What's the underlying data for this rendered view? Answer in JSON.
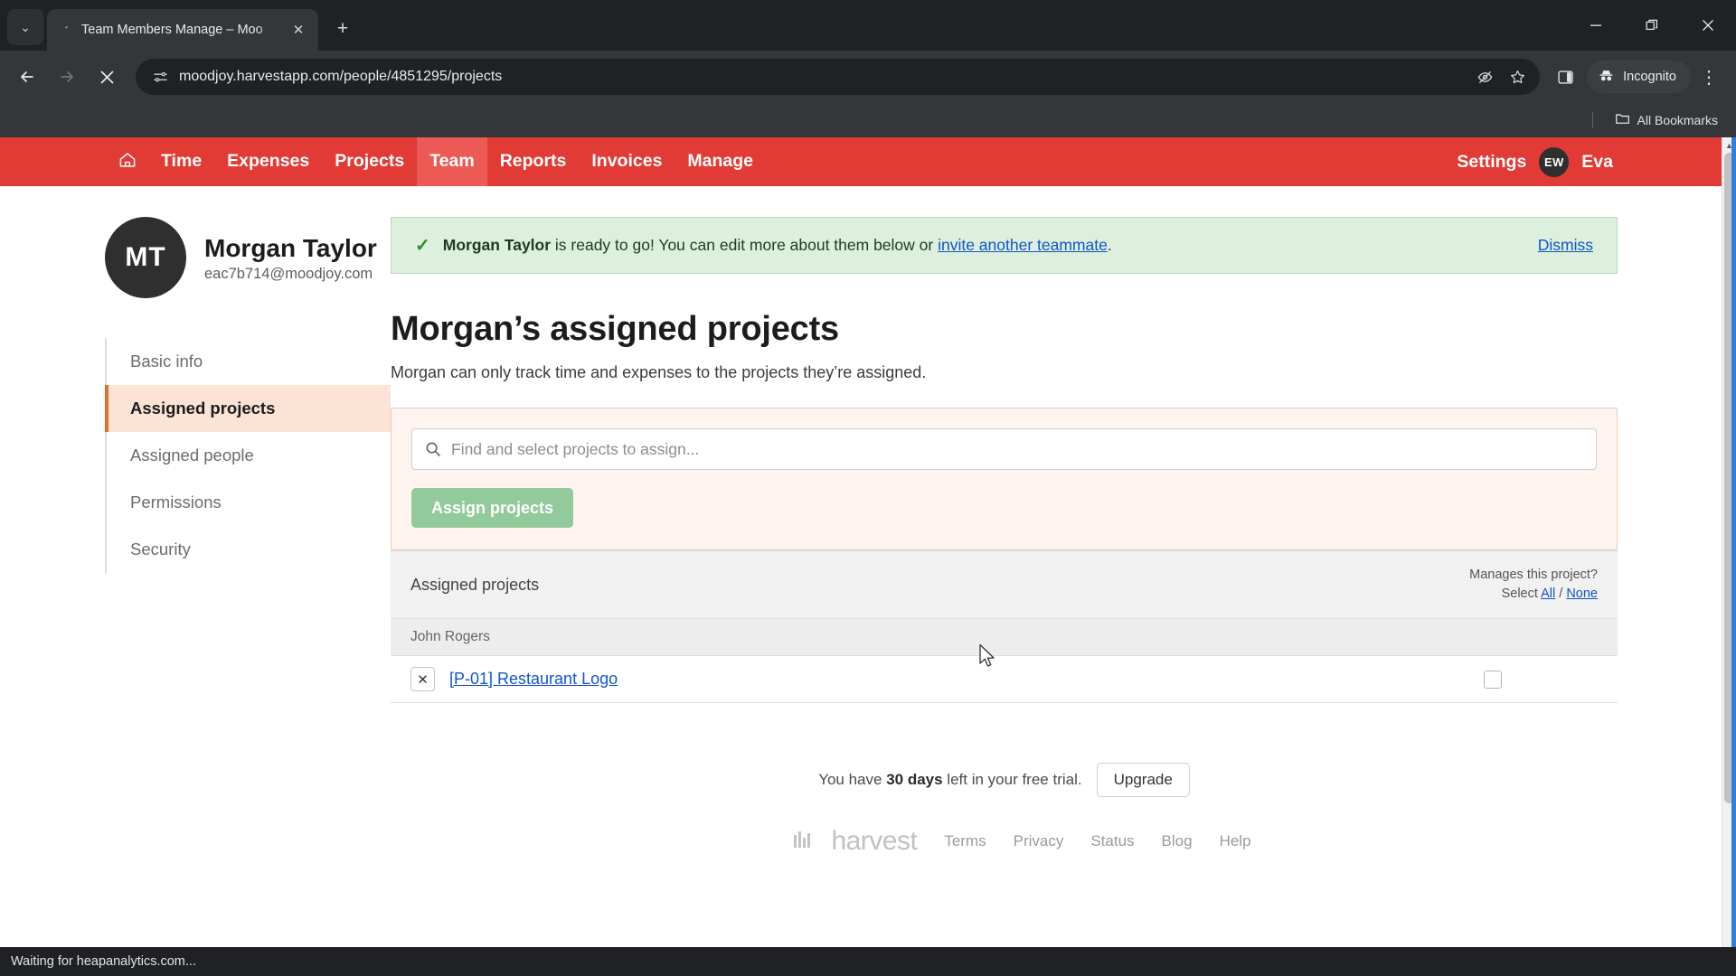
{
  "browser": {
    "tab": {
      "title": "Team Members Manage – Moo",
      "favicon_name": "harvest-favicon",
      "close_label": "✕",
      "new_tab_label": "+"
    },
    "tab_search_label": "⌄",
    "window_controls": {
      "minimize": "—",
      "maximize": "❐",
      "close": "✕"
    },
    "toolbar": {
      "back": "←",
      "forward": "→",
      "stop": "✕",
      "url": "moodjoy.harvestapp.com/people/4851295/projects",
      "site_info_name": "site-settings-icon",
      "tracking_protection": "eye-off-icon",
      "bookmark": "star-icon",
      "side_panel": "side-panel-icon",
      "incognito_label": "Incognito",
      "menu": "⋮"
    },
    "bookmarks_bar": {
      "all_bookmarks_label": "All Bookmarks"
    },
    "status_text": "Waiting for heapanalytics.com..."
  },
  "harvest": {
    "nav": {
      "home_icon": "home-icon",
      "items": [
        {
          "label": "Time",
          "active": false
        },
        {
          "label": "Expenses",
          "active": false
        },
        {
          "label": "Projects",
          "active": false
        },
        {
          "label": "Team",
          "active": true
        },
        {
          "label": "Reports",
          "active": false
        },
        {
          "label": "Invoices",
          "active": false
        },
        {
          "label": "Manage",
          "active": false
        }
      ],
      "settings_label": "Settings",
      "avatar_initials": "EW",
      "user_name": "Eva"
    },
    "profile": {
      "initials": "MT",
      "name": "Morgan Taylor",
      "email": "eac7b714@moodjoy.com"
    },
    "sidebar": {
      "items": [
        {
          "label": "Basic info"
        },
        {
          "label": "Assigned projects"
        },
        {
          "label": "Assigned people"
        },
        {
          "label": "Permissions"
        },
        {
          "label": "Security"
        }
      ]
    },
    "banner": {
      "check_icon": "checkmark-icon",
      "bold_name": "Morgan Taylor",
      "text_mid": " is ready to go! You can edit more about them below or ",
      "link": "invite another teammate",
      "text_end": ".",
      "dismiss": "Dismiss"
    },
    "page": {
      "title": "Morgan’s assigned projects",
      "subtitle": "Morgan can only track time and expenses to the projects they’re assigned."
    },
    "assign": {
      "search_placeholder": "Find and select projects to assign...",
      "search_value": "",
      "search_icon": "search-icon",
      "button_label": "Assign projects"
    },
    "table": {
      "header_left": "Assigned projects",
      "header_right_line1": "Manages this project?",
      "header_right_prefix": "Select ",
      "header_right_all": "All",
      "header_right_sep": " / ",
      "header_right_none": "None",
      "groups": [
        {
          "name": "John Rogers",
          "rows": [
            {
              "remove_label": "✕",
              "project": "[P-01] Restaurant Logo",
              "manages_checked": false
            }
          ]
        }
      ]
    },
    "trial": {
      "prefix": "You have ",
      "days": "30 days",
      "suffix": " left in your free trial.",
      "upgrade_label": "Upgrade"
    },
    "footer": {
      "logo_word": "harvest",
      "links": [
        "Terms",
        "Privacy",
        "Status",
        "Blog",
        "Help"
      ]
    },
    "colors": {
      "brand_red": "#e23a35",
      "active_nav": "#eb5a55",
      "sidebar_active_bg": "#fbe3d5",
      "sidebar_active_bar": "#e2702b",
      "banner_bg": "#ddf0dd",
      "assign_box_bg": "#fdf4ef",
      "assign_button": "#92ca9c",
      "link_blue": "#1155cc"
    }
  }
}
